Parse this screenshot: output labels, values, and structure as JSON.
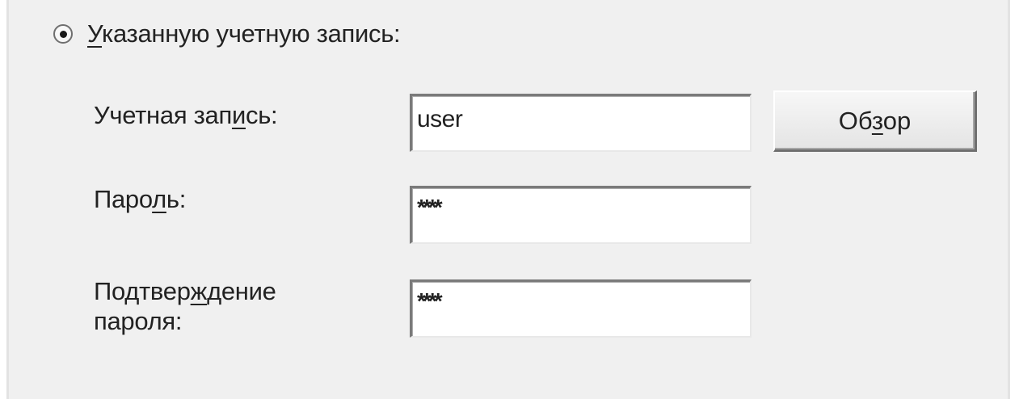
{
  "radio_option": {
    "label_underlined": "У",
    "label_rest": "казанную учетную запись:",
    "selected": true
  },
  "account": {
    "label_before": "Учетная зап",
    "label_underlined": "и",
    "label_after": "сь:",
    "value": "user"
  },
  "browse_button": {
    "label_before": "Об",
    "label_underlined": "з",
    "label_after": "ор"
  },
  "password": {
    "label_before": "Паро",
    "label_underlined": "л",
    "label_after": "ь:",
    "value": "****"
  },
  "confirm_password": {
    "label_line1_before": "Подтвер",
    "label_line1_underlined": "ж",
    "label_line1_after": "дение",
    "label_line2": "пароля:",
    "value": "****"
  }
}
